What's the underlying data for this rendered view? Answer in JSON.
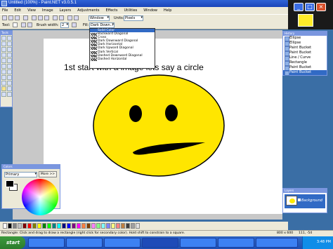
{
  "window": {
    "title": "Untitled (100%) - Paint.NET v3.0.5.1"
  },
  "window_buttons": {
    "minimize": "_",
    "maximize": "□",
    "close": "×"
  },
  "menu": [
    "File",
    "Edit",
    "View",
    "Image",
    "Layers",
    "Adjustments",
    "Effects",
    "Utilities",
    "Window",
    "Help"
  ],
  "toolbar": {
    "window_combo": "Window",
    "units_label": "Units:",
    "units_value": "Pixels",
    "tool_label": "Tool:",
    "brush_width_label": "Brush width:",
    "brush_width_value": "2",
    "fill_label": "Fill:",
    "fill_value": "Dark Down..."
  },
  "dropdown": {
    "items": [
      "Solid Color",
      "Backward Diagonal",
      "Cross",
      "Dark Downward Diagonal",
      "Dark Horizontal",
      "Dark Upward Diagonal",
      "Dark Vertical",
      "Dashed Downward Diagonal",
      "Dashed Horizontal"
    ],
    "selected": "Solid Color"
  },
  "tools_panel": {
    "title": "Tools"
  },
  "canvas_text": "1st start with a image lets say a circle",
  "history": {
    "title": "History",
    "items": [
      "Ellipse",
      "Ellipse",
      "Paint Bucket",
      "Paint Bucket",
      "Line / Curve",
      "Rectangle",
      "Paint Bucket",
      "Paint Bucket"
    ],
    "selected_index": 7
  },
  "layers": {
    "title": "Layers",
    "layer_name": "Background"
  },
  "colors": {
    "title": "Colors",
    "mode": "Primary",
    "more_button": "More >>"
  },
  "palette": [
    "#ffffff",
    "#000000",
    "#808080",
    "#c0c0c0",
    "#800000",
    "#ff0000",
    "#808000",
    "#ffff00",
    "#008000",
    "#00ff00",
    "#008080",
    "#00ffff",
    "#000080",
    "#0000ff",
    "#800080",
    "#ff00ff",
    "#ff8040",
    "#804000",
    "#ff80ff",
    "#80ff80",
    "#80ffff",
    "#8080ff",
    "#ffff80",
    "#ff8080",
    "#c08040",
    "#404040",
    "#a0a0a0",
    "#e0e0e0"
  ],
  "status": {
    "hint": "Rectangle: Click and drag to draw a rectangle (right click for secondary color). Hold shift to constrain to a square.",
    "size": "800 x 600",
    "coords": "111, -54"
  },
  "taskbar": {
    "start": "start",
    "tasks": [
      "",
      "",
      "",
      "",
      "",
      "",
      ""
    ],
    "clock": "3:48 PM"
  },
  "colors_accent": {
    "face": "#ffe600",
    "features": "#000000"
  }
}
